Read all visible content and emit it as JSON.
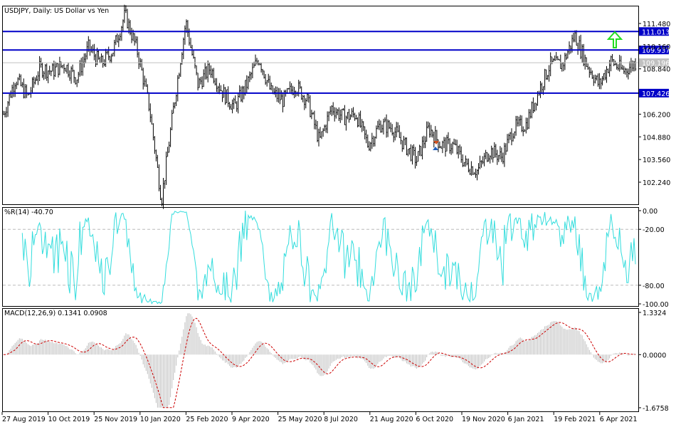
{
  "chart_data": [
    {
      "type": "ohlc",
      "title": "USDJPY, Daily:  US Dollar vs Yen",
      "symbol": "USDJPY",
      "timeframe": "Daily",
      "description": "US Dollar vs Yen",
      "y_ticks": [
        "111.480",
        "110.160",
        "108.840",
        "106.200",
        "104.880",
        "103.560",
        "102.240"
      ],
      "y_tick_values": [
        111.48,
        110.16,
        108.84,
        106.2,
        104.88,
        103.56,
        102.24
      ],
      "x_ticks": [
        "27 Aug 2019",
        "10 Oct 2019",
        "25 Nov 2019",
        "10 Jan 2020",
        "25 Feb 2020",
        "9 Apr 2020",
        "25 May 2020",
        "8 Jul 2020",
        "21 Aug 2020",
        "6 Oct 2020",
        "19 Nov 2020",
        "6 Jan 2021",
        "19 Feb 2021",
        "6 Apr 2021"
      ],
      "approx_closes_by_period": [
        106.2,
        108.3,
        107.2,
        108.9,
        108.7,
        109.1,
        108.3,
        110.1,
        109.1,
        109.9,
        112.0,
        109.9,
        106.6,
        101.2,
        106.6,
        111.6,
        107.9,
        108.9,
        107.5,
        106.6,
        107.9,
        109.5,
        107.5,
        107.0,
        107.9,
        107.0,
        104.6,
        106.6,
        106.0,
        106.2,
        104.4,
        105.6,
        105.4,
        104.4,
        103.5,
        105.4,
        104.4,
        104.4,
        103.3,
        102.9,
        104.1,
        103.7,
        105.4,
        105.6,
        107.5,
        109.1,
        109.1,
        110.8,
        109.1,
        107.9,
        109.3,
        108.7,
        109.2
      ],
      "horizontal_levels": [
        {
          "label": "111.013",
          "value": 111.013,
          "color": "#0000c8"
        },
        {
          "label": "109.937",
          "value": 109.937,
          "color": "#0000c8"
        },
        {
          "label": "107.426",
          "value": 107.426,
          "color": "#0000c8"
        }
      ],
      "current_price": {
        "label": "109.196",
        "value": 109.196,
        "color": "#c0c0c0"
      },
      "annotations": [
        {
          "type": "arrow-up",
          "color": "#22dd22",
          "value": 110.6
        }
      ]
    },
    {
      "type": "line",
      "title": "%R(14) -40.70",
      "name": "%R(14)",
      "last_value": "-40.70",
      "color": "#33dddd",
      "y_ticks": [
        "0.00",
        "-20.00",
        "-80.00",
        "-100.00"
      ],
      "ylim": [
        -100,
        0
      ],
      "levels": [
        -20,
        -80
      ]
    },
    {
      "type": "bar",
      "title": "MACD(12,26,9) 0.1341 0.0908",
      "name": "MACD(12,26,9)",
      "macd_value": "0.1341",
      "signal_value": "0.0908",
      "histogram_color": "#c0c0c0",
      "signal_color": "#cc0000",
      "y_ticks": [
        "1.3324",
        "0.0000",
        "-1.6758"
      ],
      "ylim": [
        -1.6758,
        1.3324
      ]
    }
  ]
}
